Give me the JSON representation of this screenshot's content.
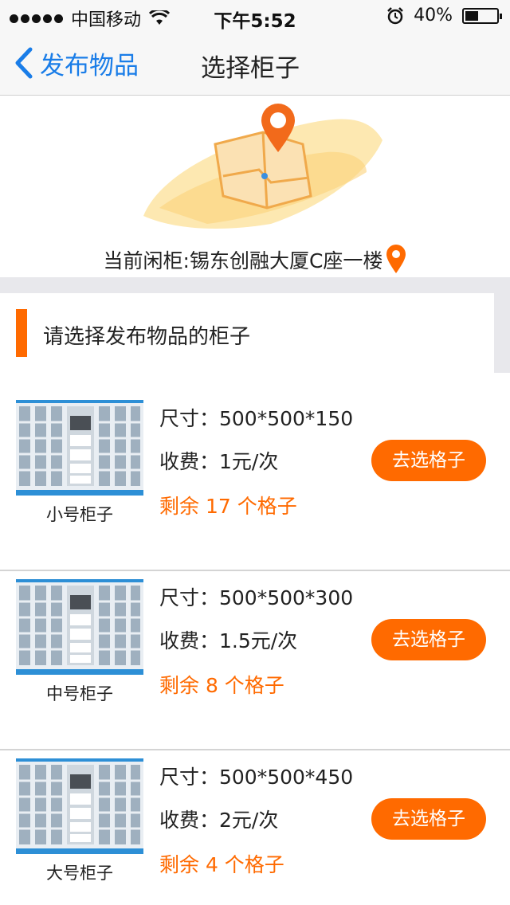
{
  "status_bar": {
    "carrier": "中国移动",
    "time": "下午5:52",
    "battery": "40%",
    "battery_level": 0.4
  },
  "nav": {
    "back_label": "发布物品",
    "title": "选择柜子"
  },
  "hero": {
    "location_text": "当前闲柜:锡东创融大厦C座一楼"
  },
  "section": {
    "title": "请选择发布物品的柜子"
  },
  "lockers": [
    {
      "name": "小号柜子",
      "size": "尺寸：500*500*150",
      "fee": "收费：1元/次",
      "remaining": "剩余 17 个格子",
      "button": "去选格子"
    },
    {
      "name": "中号柜子",
      "size": "尺寸：500*500*300",
      "fee": "收费：1.5元/次",
      "remaining": "剩余 8 个格子",
      "button": "去选格子"
    },
    {
      "name": "大号柜子",
      "size": "尺寸：500*500*450",
      "fee": "收费：2元/次",
      "remaining": "剩余 4 个格子",
      "button": "去选格子"
    }
  ],
  "colors": {
    "accent": "#ff6a00",
    "link": "#1a7de8"
  }
}
